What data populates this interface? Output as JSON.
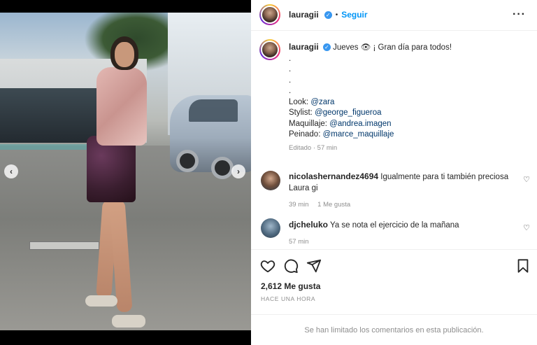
{
  "post": {
    "author": "lauragii",
    "follow_label": "Seguir",
    "separator": "•",
    "more_icon": "more-icon"
  },
  "caption": {
    "author": "lauragii",
    "line1": "Jueves 👁 ¡ Gran día para todos!",
    "dot_lines": [
      ".",
      ".",
      ".",
      "."
    ],
    "look_label": "Look:",
    "look_mention": "@zara",
    "stylist_label": "Stylist:",
    "stylist_mention": "@george_figueroa",
    "makeup_label": "Maquillaje:",
    "makeup_mention": "@andrea.imagen",
    "hair_label": "Peinado:",
    "hair_mention": "@marce_maquillaje",
    "edited": "Editado · 57 min"
  },
  "comments": [
    {
      "user": "nicolashernandez4694",
      "text": "Igualmente para ti también preciosa Laura gi",
      "time": "39 min",
      "likes": "1 Me gusta"
    },
    {
      "user": "djcheluko",
      "text": "Ya se nota el ejercicio de la mañana",
      "time": "57 min"
    }
  ],
  "engagement": {
    "likes": "2,612 Me gusta",
    "time_ago": "HACE UNA HORA"
  },
  "footer": {
    "text": "Se han limitado los comentarios en esta publicación."
  },
  "colors": {
    "accent": "#0095f6",
    "verified": "#3897f0",
    "mention": "#00376b",
    "muted": "#8e8e8e"
  }
}
